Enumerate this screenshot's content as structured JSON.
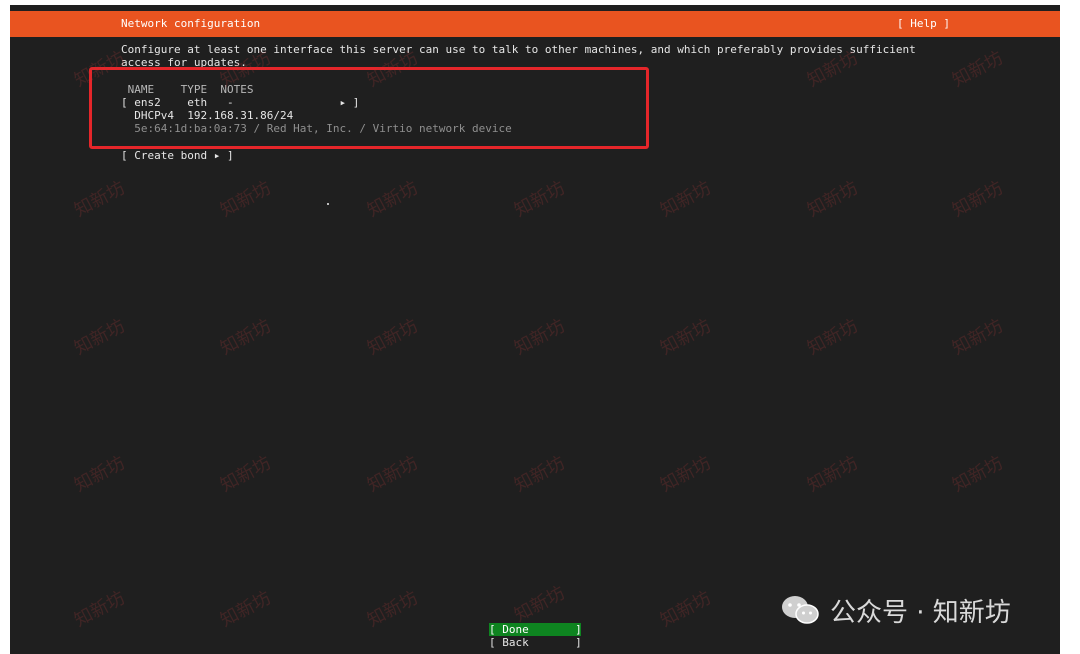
{
  "header": {
    "title": "Network configuration",
    "help": "[ Help ]"
  },
  "description": {
    "line1": "Configure at least one interface this server can use to talk to other machines, and which preferably provides sufficient",
    "line2": "access for updates."
  },
  "interfaces": {
    "columns_header": " NAME    TYPE  NOTES",
    "row": "[ ens2    eth   -                ▸ ]",
    "dhcp": "  DHCPv4  192.168.31.86/24",
    "mac_info": "  5e:64:1d:ba:0a:73 / Red Hat, Inc. / Virtio network device"
  },
  "create_bond": "[ Create bond ▸ ]",
  "buttons": {
    "done": "[ Done       ]",
    "back": "[ Back       ]"
  },
  "watermark": {
    "text": "知新坊"
  },
  "brand": {
    "text": "公众号 · 知新坊"
  },
  "colors": {
    "accent": "#e95420",
    "done_button": "#0e8420",
    "highlight": "#e5262a",
    "background": "#1f1f1f"
  }
}
